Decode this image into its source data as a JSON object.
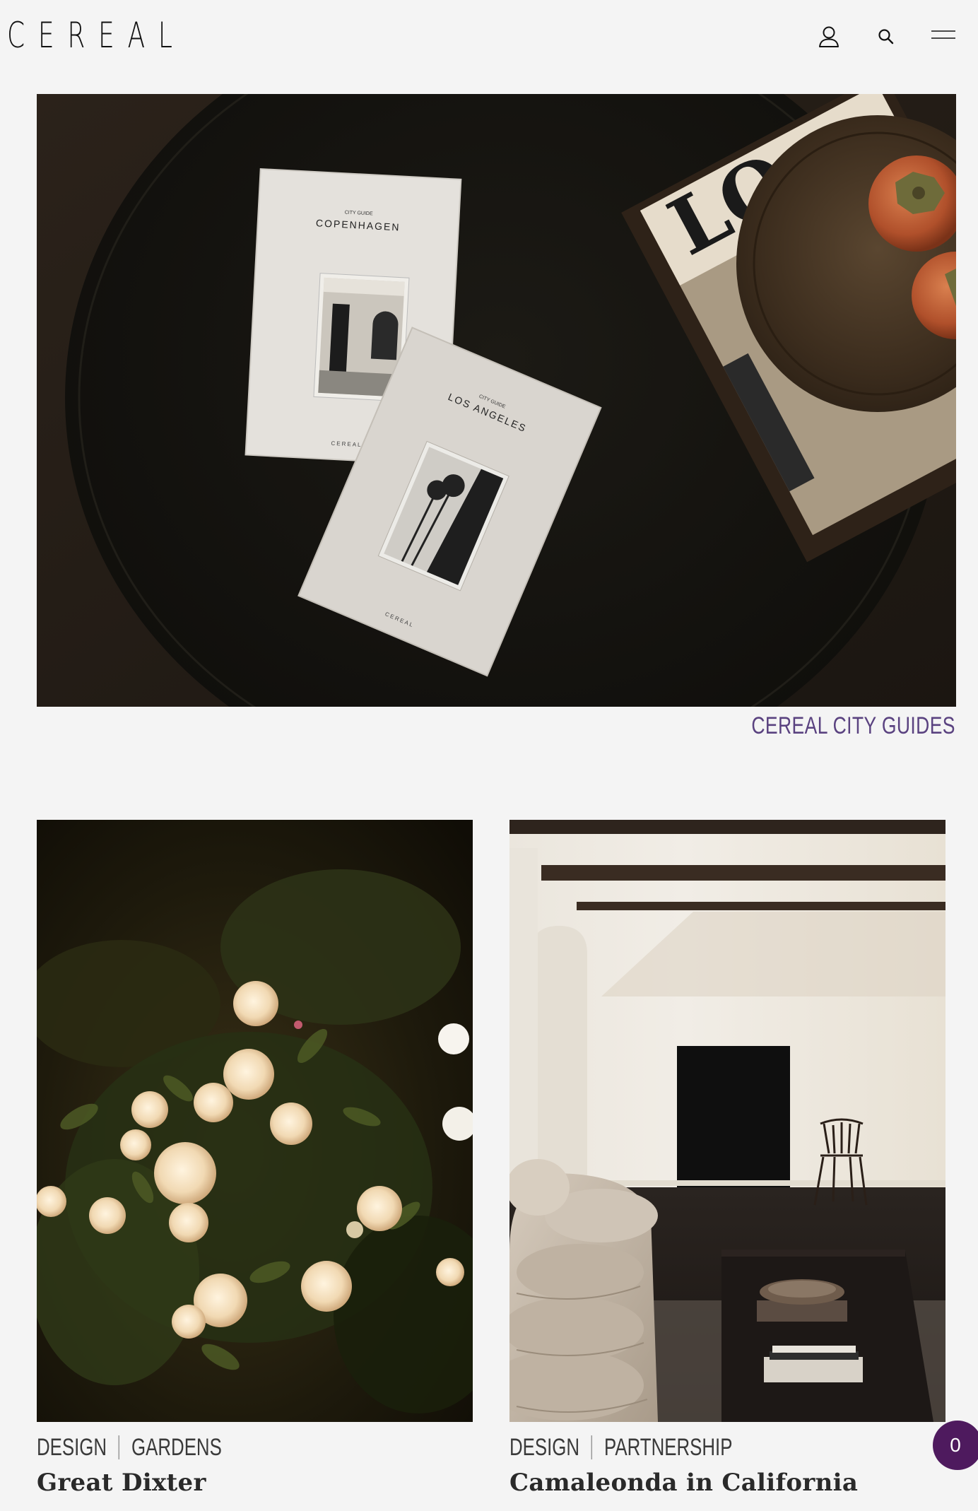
{
  "header": {
    "logo": "CEREAL",
    "icons": [
      "user-icon",
      "search-icon",
      "menu-icon"
    ]
  },
  "hero": {
    "caption": "CEREAL CITY GUIDES",
    "caption_color": "#5a4280",
    "book_copenhagen": {
      "label": "CITY GUIDE",
      "title": "COPENHAGEN",
      "brand": "CEREAL"
    },
    "book_los_angeles": {
      "label": "CITY GUIDE",
      "title": "LOS ANGELES",
      "brand": "CEREAL"
    }
  },
  "cards": [
    {
      "category": "DESIGN",
      "subcategory": "GARDENS",
      "title": "Great Dixter"
    },
    {
      "category": "DESIGN",
      "subcategory": "PARTNERSHIP",
      "title": "Camaleonda in California"
    }
  ],
  "cart": {
    "count": "0",
    "color": "#4e1a5e"
  }
}
